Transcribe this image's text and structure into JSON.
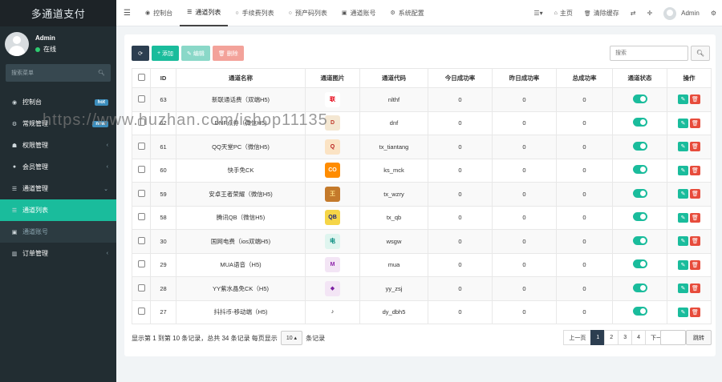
{
  "sidebar": {
    "logo": "多通道支付",
    "user": {
      "name": "Admin",
      "status": "在线"
    },
    "search_placeholder": "搜索菜单",
    "items": [
      {
        "label": "控制台",
        "icon": "dashboard-icon",
        "badge": "hot"
      },
      {
        "label": "常规管理",
        "icon": "cogs-icon",
        "badge": "new"
      },
      {
        "label": "权限管理",
        "icon": "group-icon"
      },
      {
        "label": "会员管理",
        "icon": "user-circle-icon"
      },
      {
        "label": "通道管理",
        "icon": "list-icon"
      },
      {
        "label": "通道列表",
        "icon": "list-icon"
      },
      {
        "label": "通道账号",
        "icon": "account-icon"
      },
      {
        "label": "订单管理",
        "icon": "chart-icon"
      }
    ]
  },
  "topbar": {
    "tabs": [
      {
        "label": "控制台",
        "icon": "dashboard-icon"
      },
      {
        "label": "通道列表",
        "icon": "list-icon"
      },
      {
        "label": "手续费列表",
        "icon": "circle-icon"
      },
      {
        "label": "预产码列表",
        "icon": "circle-icon"
      },
      {
        "label": "通道账号",
        "icon": "account-icon"
      },
      {
        "label": "系统配置",
        "icon": "gear-icon"
      }
    ],
    "right": {
      "home": "主页",
      "clear_cache": "清除缓存",
      "admin": "Admin"
    }
  },
  "toolbar": {
    "add": "添加",
    "edit": "编辑",
    "delete": "删除"
  },
  "search": {
    "placeholder": "搜索"
  },
  "table": {
    "headers": [
      "ID",
      "通道名称",
      "通道图片",
      "通道代码",
      "今日成功率",
      "昨日成功率",
      "总成功率",
      "通道状态",
      "操作"
    ],
    "rows": [
      {
        "id": "63",
        "name": "新联通话费（双端H5)",
        "code": "nlthf",
        "today": "0",
        "yesterday": "0",
        "total": "0",
        "icon_bg": "#ffffff",
        "icon_fg": "#e60012",
        "icon_text": "联"
      },
      {
        "id": "62",
        "name": "DNF点券（微信H5)",
        "code": "dnf",
        "today": "0",
        "yesterday": "0",
        "total": "0",
        "icon_bg": "#f4e7d2",
        "icon_fg": "#c0392b",
        "icon_text": "D"
      },
      {
        "id": "61",
        "name": "QQ天堂PC（微信H5)",
        "code": "tx_tiantang",
        "today": "0",
        "yesterday": "0",
        "total": "0",
        "icon_bg": "#fbe3c4",
        "icon_fg": "#b71c1c",
        "icon_text": "Q"
      },
      {
        "id": "60",
        "name": "快手免CK",
        "code": "ks_mck",
        "today": "0",
        "yesterday": "0",
        "total": "0",
        "icon_bg": "#ff8c00",
        "icon_fg": "#ffffff",
        "icon_text": "CO"
      },
      {
        "id": "59",
        "name": "安卓王者荣耀（微信H5)",
        "code": "tx_wzry",
        "today": "0",
        "yesterday": "0",
        "total": "0",
        "icon_bg": "#c47a2b",
        "icon_fg": "#ffe082",
        "icon_text": "王"
      },
      {
        "id": "58",
        "name": "腾讯QB（微信H5)",
        "code": "tx_qb",
        "today": "0",
        "yesterday": "0",
        "total": "0",
        "icon_bg": "#f5d547",
        "icon_fg": "#1a237e",
        "icon_text": "QB"
      },
      {
        "id": "30",
        "name": "国网电费（ios双端H5)",
        "code": "wsgw",
        "today": "0",
        "yesterday": "0",
        "total": "0",
        "icon_bg": "#dff5ef",
        "icon_fg": "#00897b",
        "icon_text": "电"
      },
      {
        "id": "29",
        "name": "MUA语音（H5)",
        "code": "mua",
        "today": "0",
        "yesterday": "0",
        "total": "0",
        "icon_bg": "#f3e5f5",
        "icon_fg": "#8e24aa",
        "icon_text": "M"
      },
      {
        "id": "28",
        "name": "YY紫水晶免CK（H5)",
        "code": "yy_zsj",
        "today": "0",
        "yesterday": "0",
        "total": "0",
        "icon_bg": "#f3e5f5",
        "icon_fg": "#7b1fa2",
        "icon_text": "◆"
      },
      {
        "id": "27",
        "name": "抖抖币-移动端（H5)",
        "code": "dy_dbh5",
        "today": "0",
        "yesterday": "0",
        "total": "0",
        "icon_bg": "#ffffff",
        "icon_fg": "#111111",
        "icon_text": "♪"
      }
    ]
  },
  "footer": {
    "info": "显示第 1 到第 10 条记录，总共 34 条记录 每页显示",
    "page_size": "10",
    "page_size_suffix": "条记录"
  },
  "pager": {
    "prev": "上一页",
    "pages": [
      "1",
      "2",
      "3",
      "4"
    ],
    "next": "下一页",
    "jump": "跳转"
  },
  "watermark": "https://www.huzhan.com/ishop11135",
  "colors": {
    "accent": "#1abc9c",
    "sidebar": "#222d32",
    "danger": "#e74c3c",
    "dark": "#2c3e50"
  }
}
